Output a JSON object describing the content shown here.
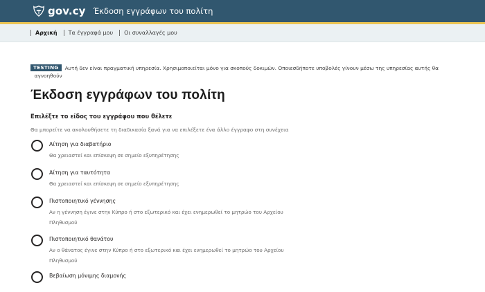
{
  "header": {
    "logo_text": "gov.cy",
    "service_title": "Έκδοση εγγράφων του πολίτη",
    "accent_color": "#ebc553",
    "bg_color": "#31576f"
  },
  "nav": {
    "items": [
      {
        "label": "Αρχική",
        "active": true
      },
      {
        "label": "Τα έγγραφά μου",
        "active": false
      },
      {
        "label": "Οι συναλλαγές μου",
        "active": false
      }
    ]
  },
  "banner": {
    "tag": "TESTING",
    "text_line1": "Αυτή δεν είναι πραγματική υπηρεσία. Χρησιμοποιείται μόνο για σκοπούς δοκιμών. Οποιεσδήποτε υποβολές γίνουν μέσω της υπηρεσίας αυτής θα",
    "text_line2": "αγνοηθούν"
  },
  "main": {
    "title": "Έκδοση εγγράφων του πολίτη",
    "question": "Επιλέξτε το είδος του εγγράφου που θέλετε",
    "hint": "Θα μπορείτε να ακολουθήσετε τη διαδικασία ξανά για να επιλέξετε ένα άλλο έγγραφο στη συνέχεια",
    "options": [
      {
        "label": "Αίτηση για διαβατήριο",
        "desc": "Θα χρειαστεί και επίσκεψη σε σημείο εξυπηρέτησης"
      },
      {
        "label": "Αίτηση για ταυτότητα",
        "desc": "Θα χρειαστεί και επίσκεψη σε σημείο εξυπηρέτησης"
      },
      {
        "label": "Πιστοποιητικό γέννησης",
        "desc": "Αν η γέννηση έγινε στην Κύπρο ή στο εξωτερικό και έχει ενημερωθεί το μητρώο του Αρχείου Πληθυσμού"
      },
      {
        "label": "Πιστοποιητικό θανάτου",
        "desc": "Αν ο θάνατος έγινε στην Κύπρο ή στο εξωτερικό και έχει ενημερωθεί το μητρώο του Αρχείου Πληθυσμού"
      },
      {
        "label": "Βεβαίωση μόνιμης διαμονής",
        "desc": ""
      }
    ]
  }
}
